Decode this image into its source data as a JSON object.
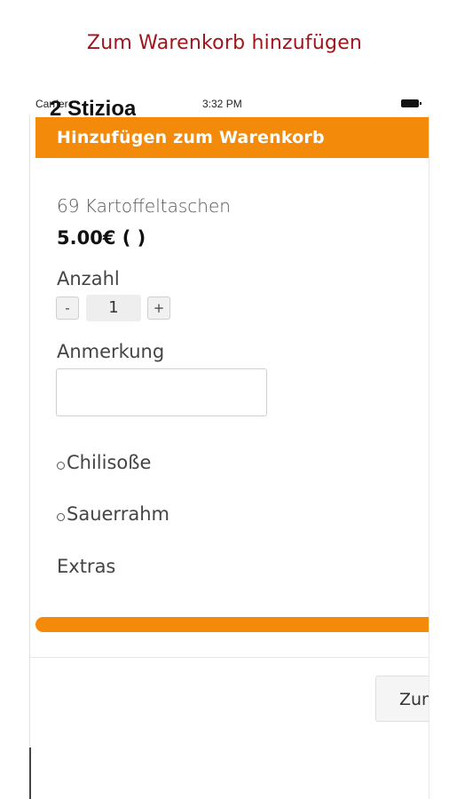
{
  "caption": "Zum Warenkorb hinzufügen",
  "status_bar": {
    "carrier": "Carrier",
    "time": "3:32 PM",
    "battery_icon": "battery-icon"
  },
  "app_title": "2 Stizioa",
  "modal": {
    "title": "Hinzufügen zum Warenkorb",
    "header_color": "#f48a0a",
    "product": {
      "name": "69 Kartoffeltaschen",
      "price": "5.00€ ( )"
    },
    "quantity": {
      "label": "Anzahl",
      "decrement_label": "-",
      "value": "1",
      "increment_label": "+"
    },
    "note": {
      "label": "Anmerkung",
      "value": ""
    },
    "options": [
      {
        "label": "Chilisoße",
        "selected": false
      },
      {
        "label": "Sauerrahm",
        "selected": false
      }
    ],
    "extras_label": "Extras",
    "progress_color": "#f48a0a",
    "add_button_label": "Zum Warenkorb"
  }
}
